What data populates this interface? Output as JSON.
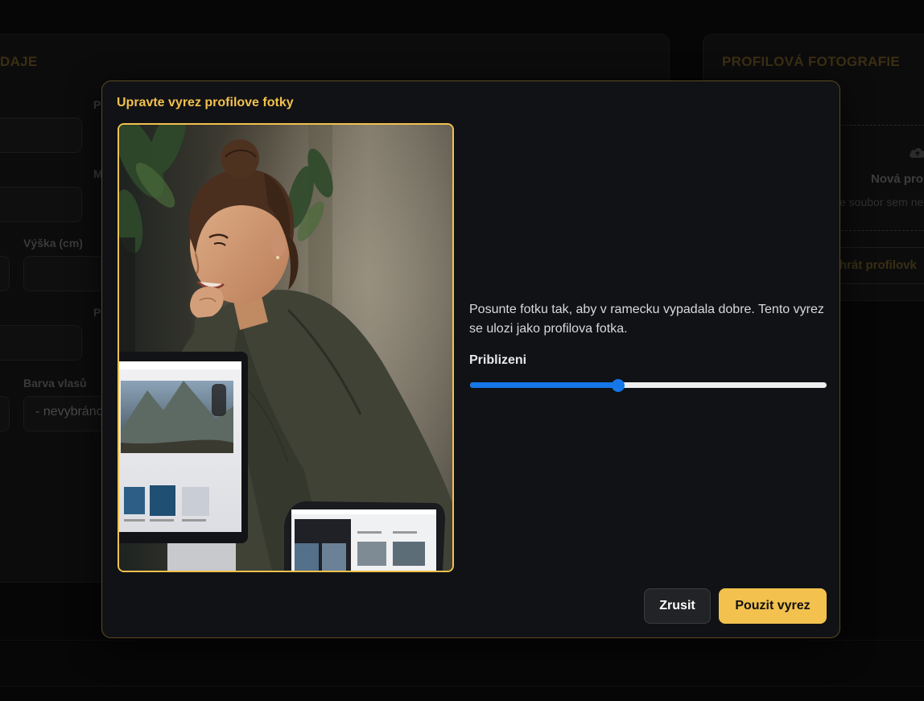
{
  "background": {
    "left_section_title": "DAJE",
    "right_section_title": "PROFILOVÁ FOTOGRAFIE",
    "labels": {
      "label_p1": "P",
      "label_m": "M",
      "height_label": "Výška (cm)",
      "label_p2": "P",
      "hair_color_label": "Barva vlasů"
    },
    "hair_color_value": "- nevybráno",
    "upload_title": "Nová pro",
    "upload_hint": "e soubor sem ne",
    "upload_button": "hrát profilovk"
  },
  "modal": {
    "title": "Upravte vyrez profilove fotky",
    "instructions": "Posunte fotku tak, aby v ramecku vypadala dobre. Tento vyrez se ulozi jako profilova fotka.",
    "zoom_label": "Priblizeni",
    "zoom_fraction": 0.415,
    "cancel_label": "Zrusit",
    "apply_label": "Pouzit vyrez"
  },
  "colors": {
    "accent": "#f2c14e",
    "slider": "#1577e8",
    "modal_bg": "#111215"
  }
}
